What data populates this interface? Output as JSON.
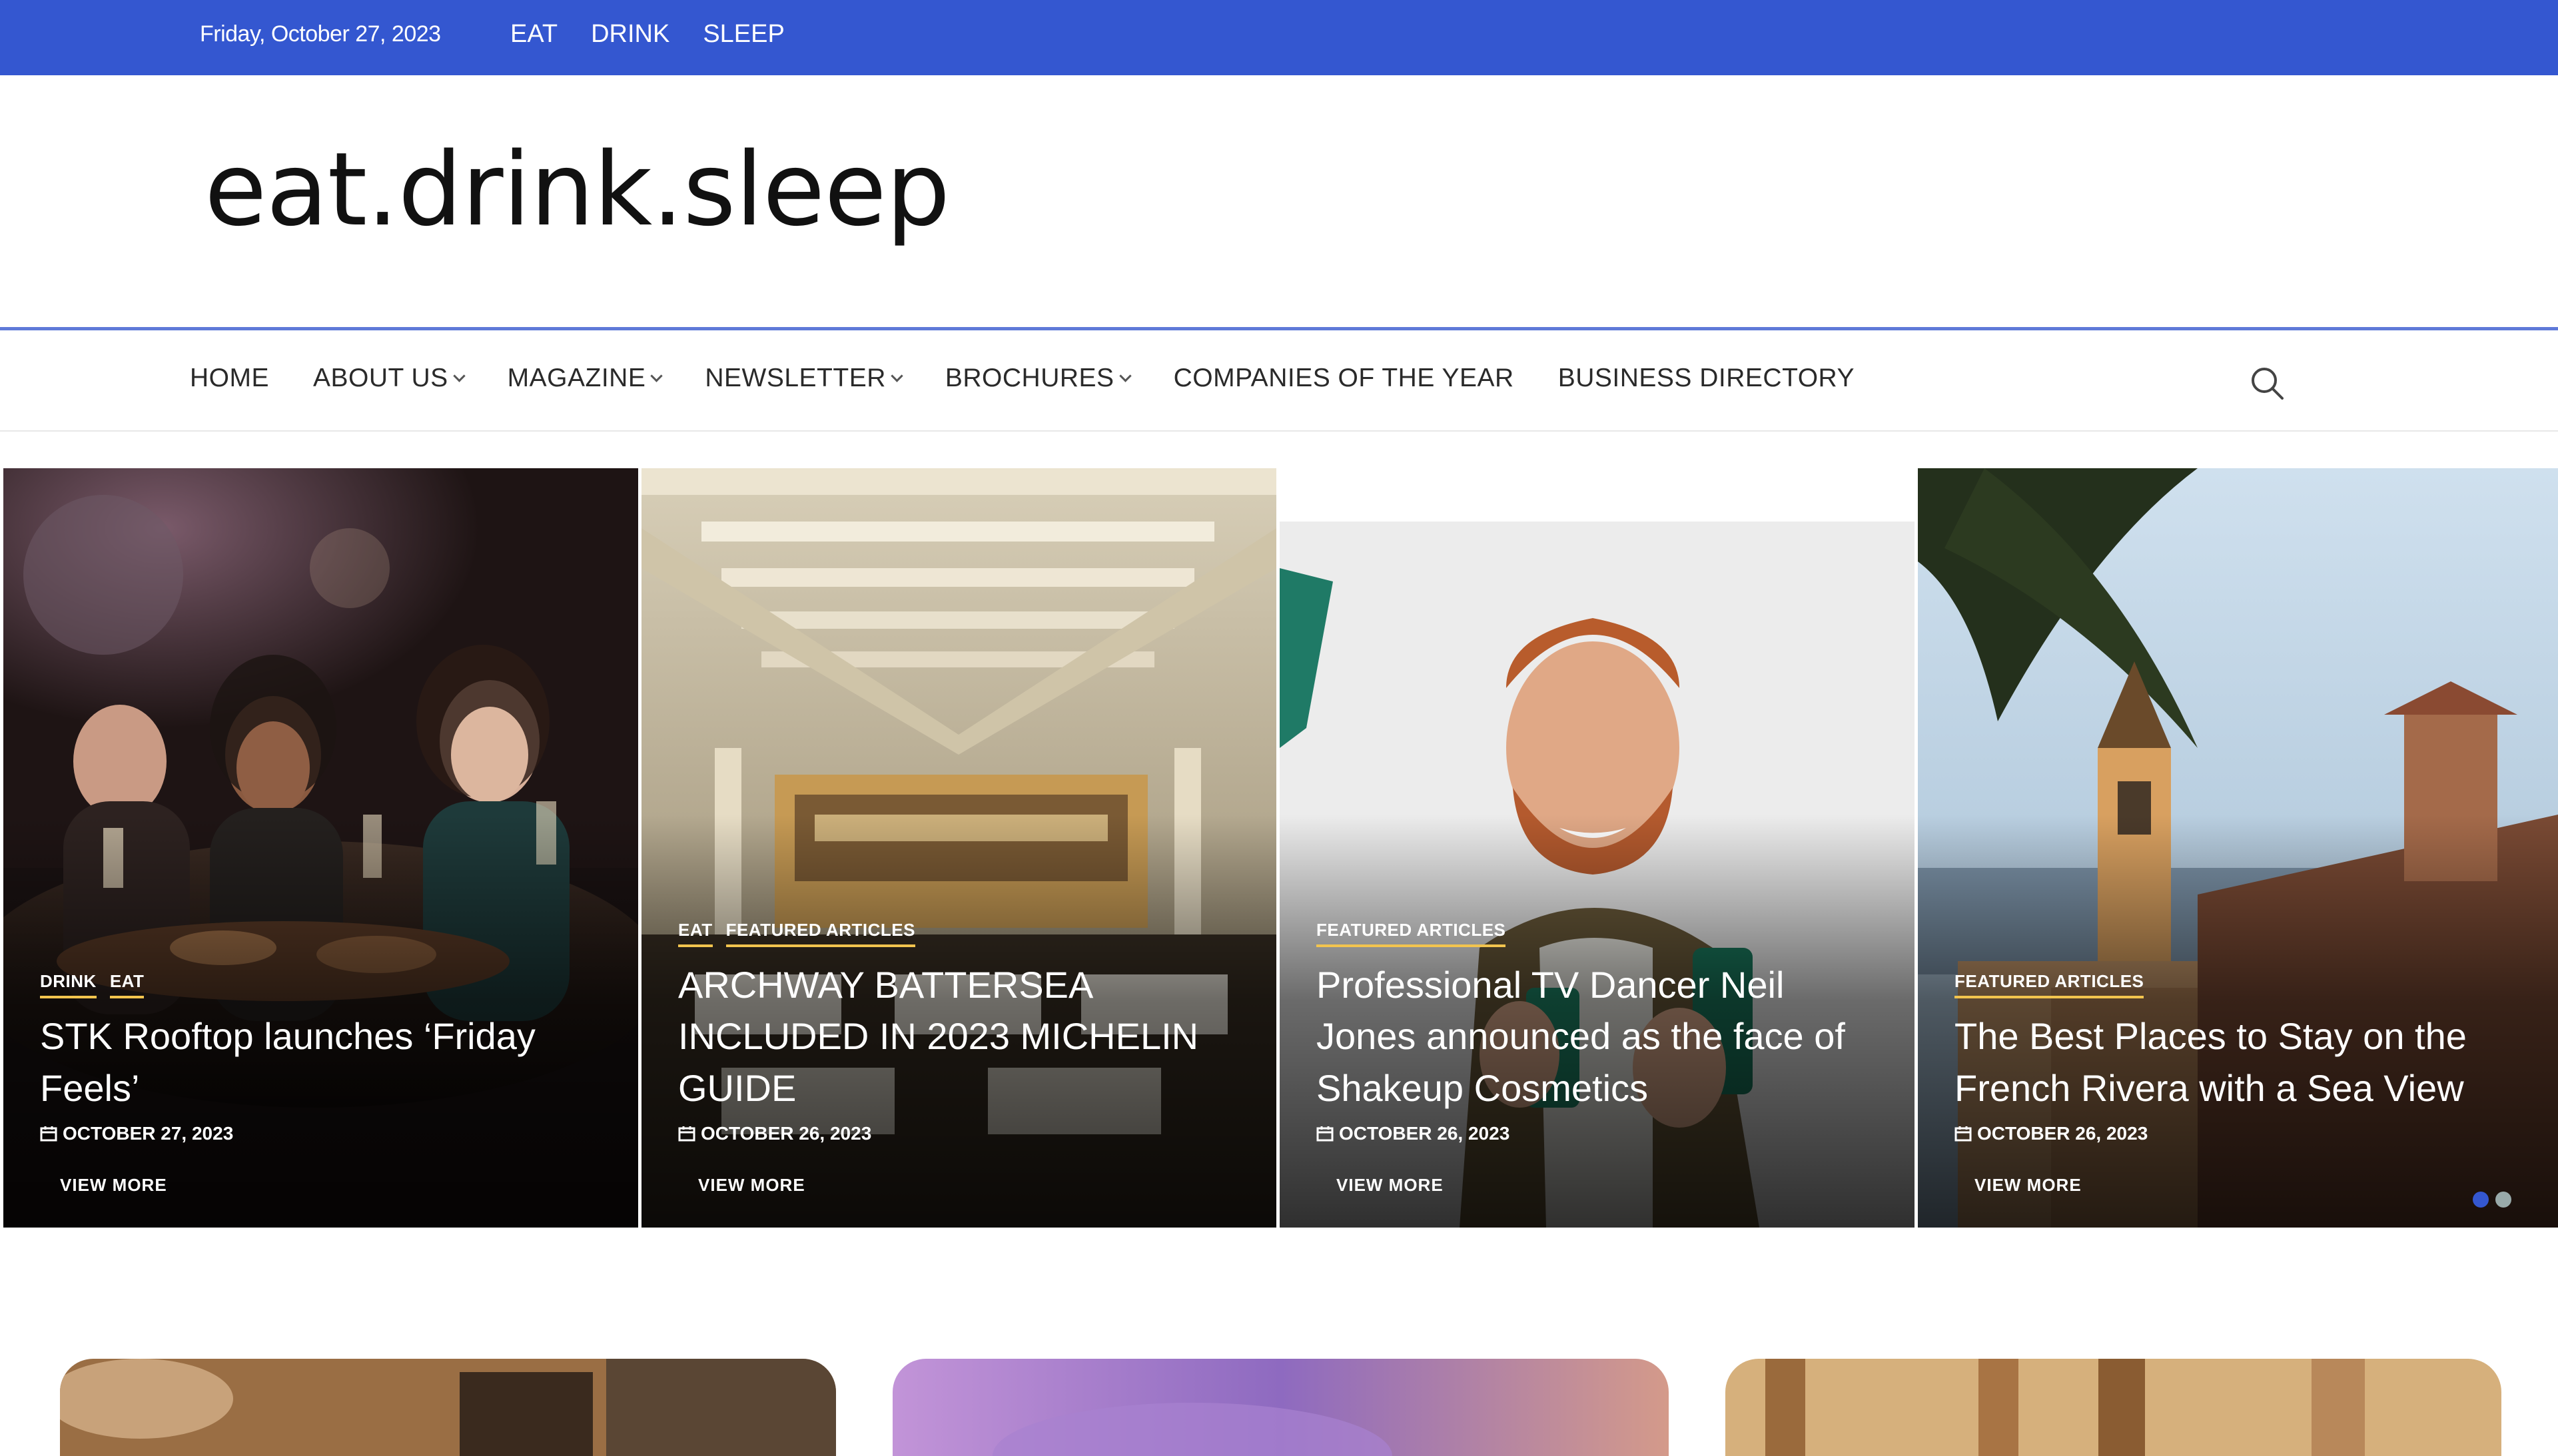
{
  "topbar": {
    "date": "Friday, October 27, 2023",
    "links": [
      "EAT",
      "DRINK",
      "SLEEP"
    ],
    "color": "#3457d0"
  },
  "header": {
    "logo": "eat.drink.sleep"
  },
  "nav": {
    "items": [
      {
        "label": "HOME",
        "dropdown": false
      },
      {
        "label": "ABOUT US",
        "dropdown": true
      },
      {
        "label": "MAGAZINE",
        "dropdown": true
      },
      {
        "label": "NEWSLETTER",
        "dropdown": true
      },
      {
        "label": "BROCHURES",
        "dropdown": true
      },
      {
        "label": "COMPANIES OF THE YEAR",
        "dropdown": false
      },
      {
        "label": "BUSINESS DIRECTORY",
        "dropdown": false
      }
    ],
    "search_icon": "search-icon"
  },
  "slider": {
    "accent_color": "#f2c44e",
    "view_more_label": "VIEW MORE",
    "slides": [
      {
        "categories": [
          "DRINK",
          "EAT"
        ],
        "title": "STK Rooftop launches ‘Friday Feels’",
        "date": "OCTOBER 27, 2023"
      },
      {
        "categories": [
          "EAT",
          "FEATURED ARTICLES"
        ],
        "title": "ARCHWAY BATTERSEA INCLUDED IN 2023 MICHELIN GUIDE",
        "date": "OCTOBER 26, 2023"
      },
      {
        "categories": [
          "FEATURED ARTICLES"
        ],
        "title": "Professional TV Dancer Neil Jones announced as the face of Shakeup Cosmetics",
        "date": "OCTOBER 26, 2023"
      },
      {
        "categories": [
          "FEATURED ARTICLES"
        ],
        "title": "The Best Places to Stay on the French Rivera with a Sea View",
        "date": "OCTOBER 26, 2023"
      }
    ],
    "dots": 2,
    "active_dot": 0
  }
}
